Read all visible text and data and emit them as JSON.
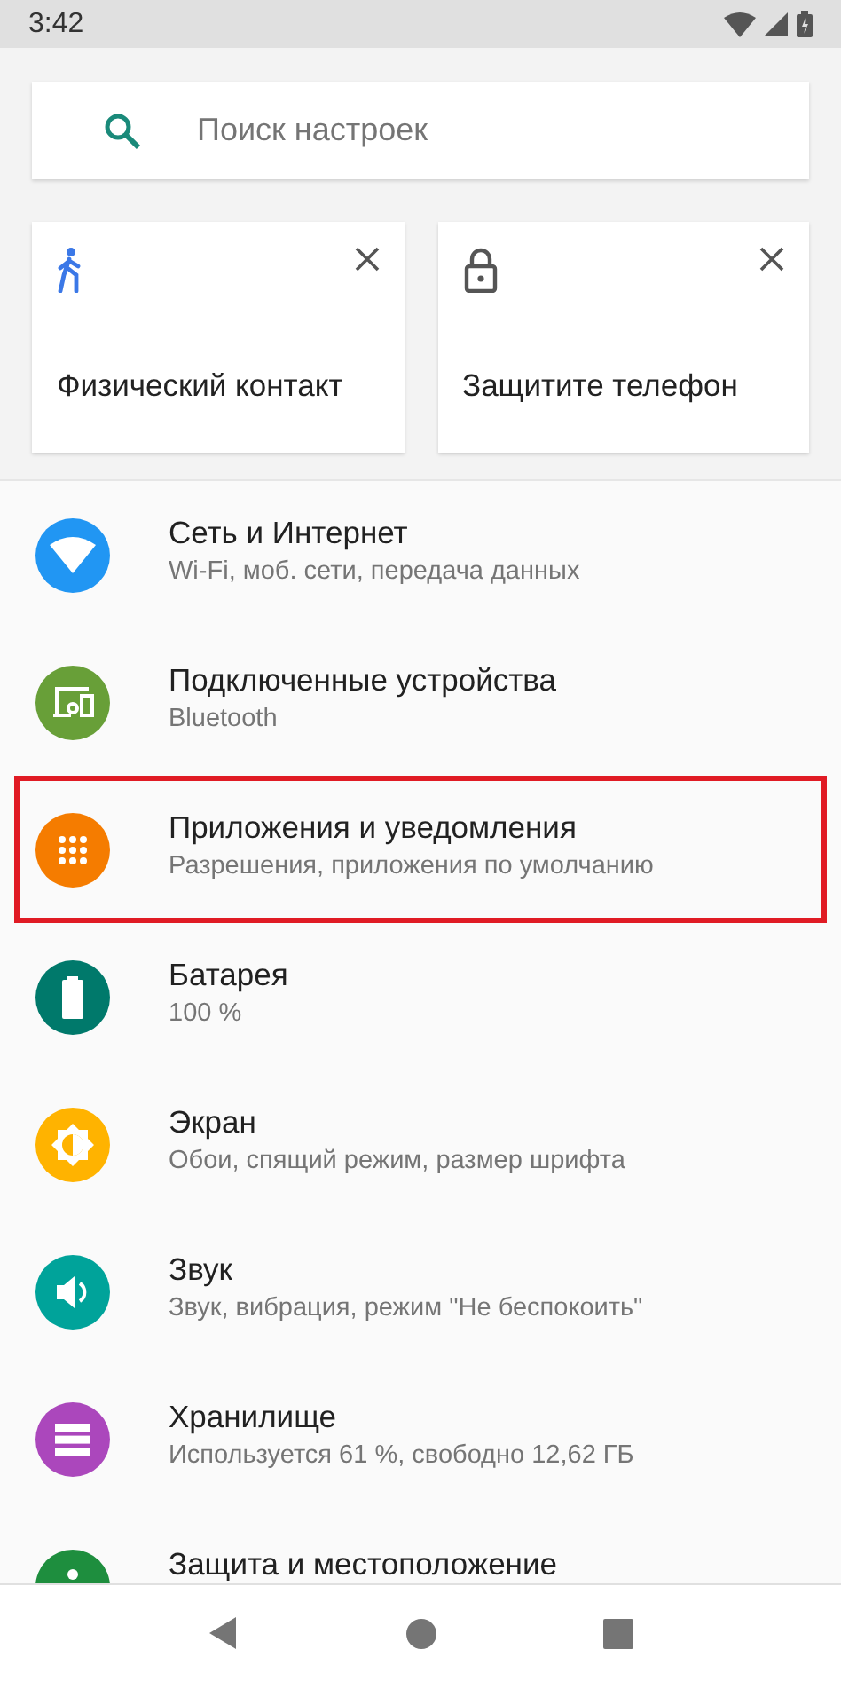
{
  "status_bar": {
    "time": "3:42"
  },
  "search": {
    "placeholder": "Поиск настроек"
  },
  "suggestions": [
    {
      "kind": "walk",
      "title": "Физический контакт"
    },
    {
      "kind": "lock",
      "title": "Защитите телефон"
    }
  ],
  "settings": [
    {
      "kind": "wifi",
      "color": "#2196f3",
      "title": "Сеть и Интернет",
      "subtitle": "Wi-Fi, моб. сети, передача данных",
      "highlighted": false
    },
    {
      "kind": "devices",
      "color": "#689f38",
      "title": "Подключенные устройства",
      "subtitle": "Bluetooth",
      "highlighted": false
    },
    {
      "kind": "apps",
      "color": "#f57c00",
      "title": "Приложения и уведомления",
      "subtitle": "Разрешения, приложения по умолчанию",
      "highlighted": true
    },
    {
      "kind": "battery",
      "color": "#00796b",
      "title": "Батарея",
      "subtitle": "100 %",
      "highlighted": false
    },
    {
      "kind": "display",
      "color": "#ffb300",
      "title": "Экран",
      "subtitle": "Обои, спящий режим, размер шрифта",
      "highlighted": false
    },
    {
      "kind": "sound",
      "color": "#00a39a",
      "title": "Звук",
      "subtitle": "Звук, вибрация, режим \"Не беспокоить\"",
      "highlighted": false
    },
    {
      "kind": "storage",
      "color": "#ab47bc",
      "title": "Хранилище",
      "subtitle": "Используется 61 %, свободно 12,62 ГБ",
      "highlighted": false
    },
    {
      "kind": "security",
      "color": "#1e8e3e",
      "title": "Защита и местоположение",
      "highlighted": false
    }
  ]
}
